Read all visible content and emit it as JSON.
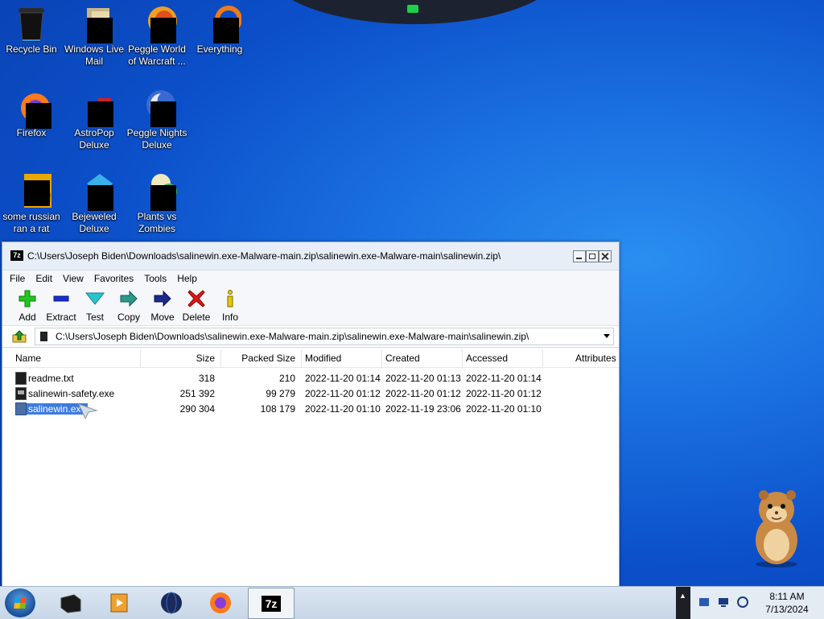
{
  "desktop": {
    "icons": [
      {
        "label": "Recycle Bin"
      },
      {
        "label": "Windows Live Mail"
      },
      {
        "label": "Peggle World of Warcraft ..."
      },
      {
        "label": "Everything"
      },
      {
        "label": "Firefox"
      },
      {
        "label": "AstroPop Deluxe"
      },
      {
        "label": "Peggle Nights Deluxe"
      },
      {
        "label": "some russian ran a rat"
      },
      {
        "label": "Bejeweled Deluxe"
      },
      {
        "label": "Plants vs Zombies"
      }
    ]
  },
  "window": {
    "app_icon_text": "7z",
    "title": "C:\\Users\\Joseph Biden\\Downloads\\salinewin.exe-Malware-main.zip\\salinewin.exe-Malware-main\\salinewin.zip\\",
    "menu": [
      "File",
      "Edit",
      "View",
      "Favorites",
      "Tools",
      "Help"
    ],
    "toolbar": [
      {
        "label": "Add",
        "icon": "plus-icon"
      },
      {
        "label": "Extract",
        "icon": "minus-icon"
      },
      {
        "label": "Test",
        "icon": "check-icon"
      },
      {
        "label": "Copy",
        "icon": "copy-arrow-icon"
      },
      {
        "label": "Move",
        "icon": "move-arrow-icon"
      },
      {
        "label": "Delete",
        "icon": "delete-x-icon"
      },
      {
        "label": "Info",
        "icon": "info-icon"
      }
    ],
    "address": "C:\\Users\\Joseph Biden\\Downloads\\salinewin.exe-Malware-main.zip\\salinewin.exe-Malware-main\\salinewin.zip\\",
    "columns": [
      "Name",
      "Size",
      "Packed Size",
      "Modified",
      "Created",
      "Accessed",
      "Attributes"
    ],
    "files": [
      {
        "name": "readme.txt",
        "size": "318",
        "packed": "210",
        "modified": "2022-11-20 01:14",
        "created": "2022-11-20 01:13",
        "accessed": "2022-11-20 01:14",
        "selected": false
      },
      {
        "name": "salinewin-safety.exe",
        "size": "251 392",
        "packed": "99 279",
        "modified": "2022-11-20 01:12",
        "created": "2022-11-20 01:12",
        "accessed": "2022-11-20 01:12",
        "selected": false
      },
      {
        "name": "salinewin.exe",
        "size": "290 304",
        "packed": "108 179",
        "modified": "2022-11-20 01:10",
        "created": "2022-11-19 23:06",
        "accessed": "2022-11-20 01:10",
        "selected": true
      }
    ]
  },
  "taskbar": {
    "seven_zip_label": "7z",
    "time": "8:11 AM",
    "date": "7/13/2024"
  }
}
